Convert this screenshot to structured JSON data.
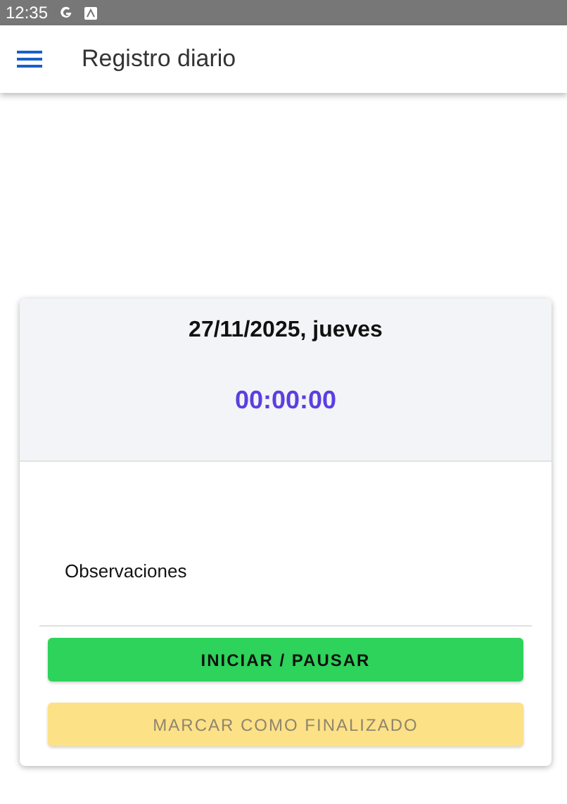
{
  "status_bar": {
    "time": "12:35"
  },
  "app_bar": {
    "title": "Registro diario"
  },
  "card": {
    "date": "27/11/2025, jueves",
    "timer": "00:00:00",
    "observations_field": {
      "label": "Observaciones"
    },
    "buttons": [
      {
        "label": "INICIAR / PAUSAR",
        "kind": "start",
        "disabled": false
      },
      {
        "label": "MARCAR COMO FINALIZADO",
        "kind": "finish",
        "disabled": true
      }
    ]
  }
}
